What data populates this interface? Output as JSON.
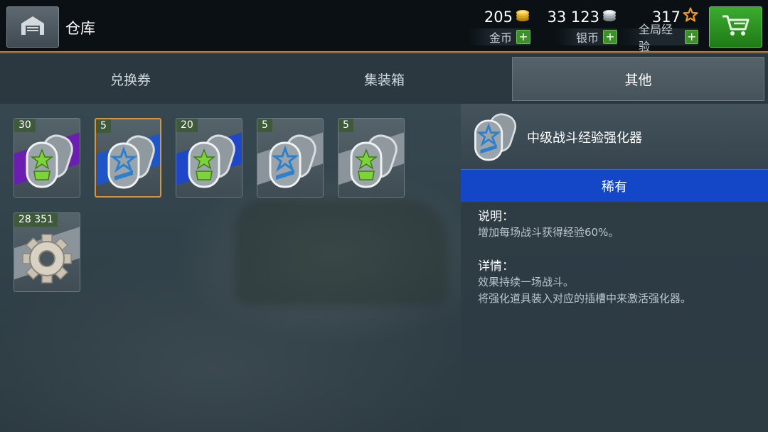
{
  "header": {
    "title": "仓库",
    "currencies": [
      {
        "value": "205",
        "label": "金币",
        "icon": "gold-coin-icon"
      },
      {
        "value": "33 123",
        "label": "银币",
        "icon": "silver-coin-icon"
      },
      {
        "value": "317",
        "label": "全局经验",
        "icon": "star-icon"
      }
    ],
    "plus": "+"
  },
  "tabs": [
    {
      "label": "兑换券",
      "active": false
    },
    {
      "label": "集装箱",
      "active": false
    },
    {
      "label": "其他",
      "active": true
    }
  ],
  "items": [
    {
      "count": "30",
      "icon": "crew-dogtag-icon",
      "stripe": "#6a1fb0",
      "selected": false
    },
    {
      "count": "5",
      "icon": "exp-booster-dogtag-icon",
      "stripe": "#1e56c8",
      "selected": true
    },
    {
      "count": "20",
      "icon": "crew-dogtag-icon",
      "stripe": "#1e46c8",
      "selected": false
    },
    {
      "count": "5",
      "icon": "exp-booster-dogtag-icon",
      "stripe": "#8a949a",
      "selected": false
    },
    {
      "count": "5",
      "icon": "crew-dogtag-icon",
      "stripe": "#8a949a",
      "selected": false
    },
    {
      "count": "28 351",
      "icon": "gear-icon",
      "stripe": "#8a949a",
      "selected": false
    }
  ],
  "detail": {
    "title": "中级战斗经验强化器",
    "rarity": "稀有",
    "rarity_color": "#1446c8",
    "description_label": "说明：",
    "description": "增加每场战斗获得经验60%。",
    "details_label": "详情：",
    "details_line1": "效果持续一场战斗。",
    "details_line2": "将强化道具装入对应的插槽中来激活强化器。"
  }
}
